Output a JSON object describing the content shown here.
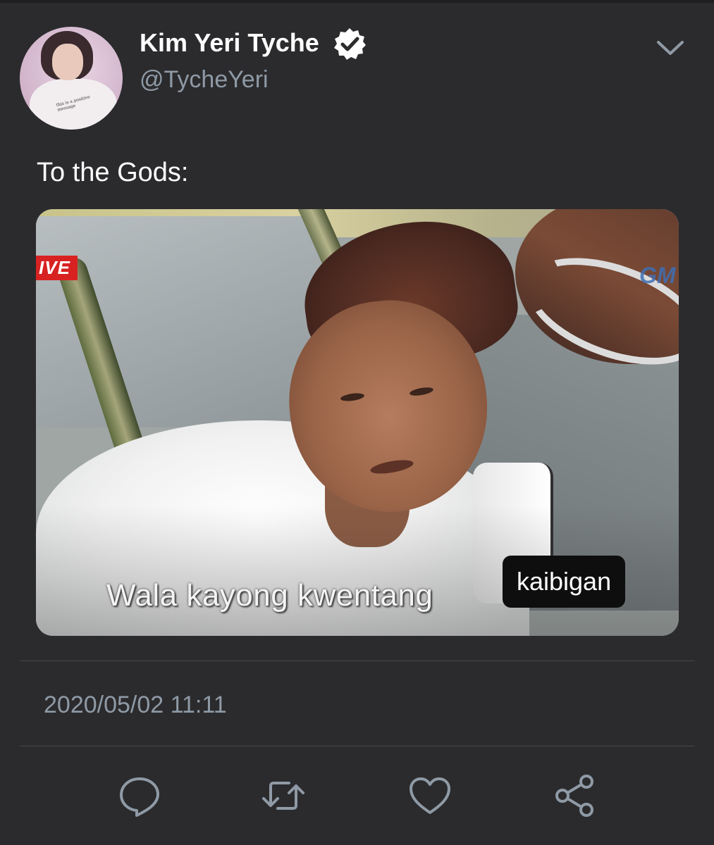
{
  "tweet": {
    "author": {
      "display_name": "Kim Yeri Tyche",
      "handle": "@TycheYeri",
      "avatar_shirt_text": "this is a positive message"
    },
    "text": "To the Gods:",
    "media": {
      "live_badge": "IVE",
      "channel_logo": "GM",
      "subtitle": "Wala kayong kwentang",
      "overlay_label": "kaibigan"
    },
    "timestamp": "2020/05/02 11:11",
    "actions": [
      "reply-icon",
      "retweet-icon",
      "like-icon",
      "share-icon"
    ]
  },
  "colors": {
    "background": "#2b2b2d",
    "secondary_text": "#8f9aa6",
    "divider": "#474749"
  }
}
